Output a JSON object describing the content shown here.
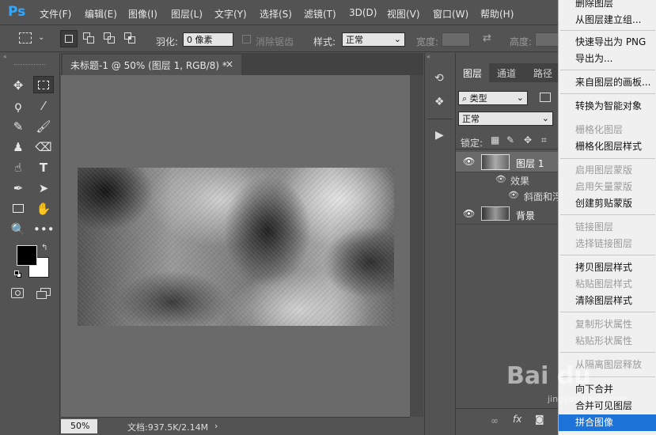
{
  "app": {
    "logo": "Ps"
  },
  "menubar": {
    "items": [
      "文件(F)",
      "编辑(E)",
      "图像(I)",
      "图层(L)",
      "文字(Y)",
      "选择(S)",
      "滤镜(T)",
      "3D(D)",
      "视图(V)",
      "窗口(W)",
      "帮助(H)"
    ]
  },
  "options": {
    "feather_label": "羽化:",
    "feather_value": "0 像素",
    "antialias_label": "消除锯齿",
    "style_label": "样式:",
    "style_value": "正常",
    "width_label": "宽度:",
    "height_label": "高度:"
  },
  "document": {
    "tab_title": "未标题-1 @ 50% (图层 1, RGB/8) *",
    "tab_close": "×",
    "zoom": "50%",
    "doc_info": "文档:937.5K/2.14M"
  },
  "layers_panel": {
    "tabs": [
      "图层",
      "通道",
      "路径"
    ],
    "filter_label": "类型",
    "blend_mode": "正常",
    "lock_label": "锁定:",
    "layers": [
      {
        "name": "图层 1"
      },
      {
        "name": "效果"
      },
      {
        "name": "斜面和浮雕"
      },
      {
        "name": "背景"
      }
    ],
    "footer_fx": "fx"
  },
  "context_menu": {
    "items": [
      {
        "label": "删除图层",
        "enabled": true
      },
      {
        "label": "从图层建立组...",
        "enabled": true
      },
      {
        "label": "快速导出为 PNG",
        "enabled": true
      },
      {
        "label": "导出为...",
        "enabled": true
      },
      {
        "label": "来自图层的画板...",
        "enabled": true
      },
      {
        "label": "转换为智能对象",
        "enabled": true
      },
      {
        "label": "栅格化图层",
        "enabled": false
      },
      {
        "label": "栅格化图层样式",
        "enabled": true
      },
      {
        "label": "启用图层蒙版",
        "enabled": false
      },
      {
        "label": "启用矢量蒙版",
        "enabled": false
      },
      {
        "label": "创建剪贴蒙版",
        "enabled": true
      },
      {
        "label": "链接图层",
        "enabled": false
      },
      {
        "label": "选择链接图层",
        "enabled": false
      },
      {
        "label": "拷贝图层样式",
        "enabled": true
      },
      {
        "label": "粘贴图层样式",
        "enabled": false
      },
      {
        "label": "清除图层样式",
        "enabled": true
      },
      {
        "label": "复制形状属性",
        "enabled": false
      },
      {
        "label": "粘贴形状属性",
        "enabled": false
      },
      {
        "label": "从隔离图层释放",
        "enabled": false
      },
      {
        "label": "向下合并",
        "enabled": true
      },
      {
        "label": "合并可见图层",
        "enabled": true
      },
      {
        "label": "拼合图像",
        "enabled": true,
        "highlighted": true
      }
    ]
  },
  "watermark": {
    "text": "Bai du",
    "url": "jingyan.baidu.com"
  },
  "colors": {
    "accent": "#31a8ff",
    "highlight": "#1e73d8",
    "ui_bg": "#535353",
    "canvas_bg": "#6a6a6a"
  }
}
